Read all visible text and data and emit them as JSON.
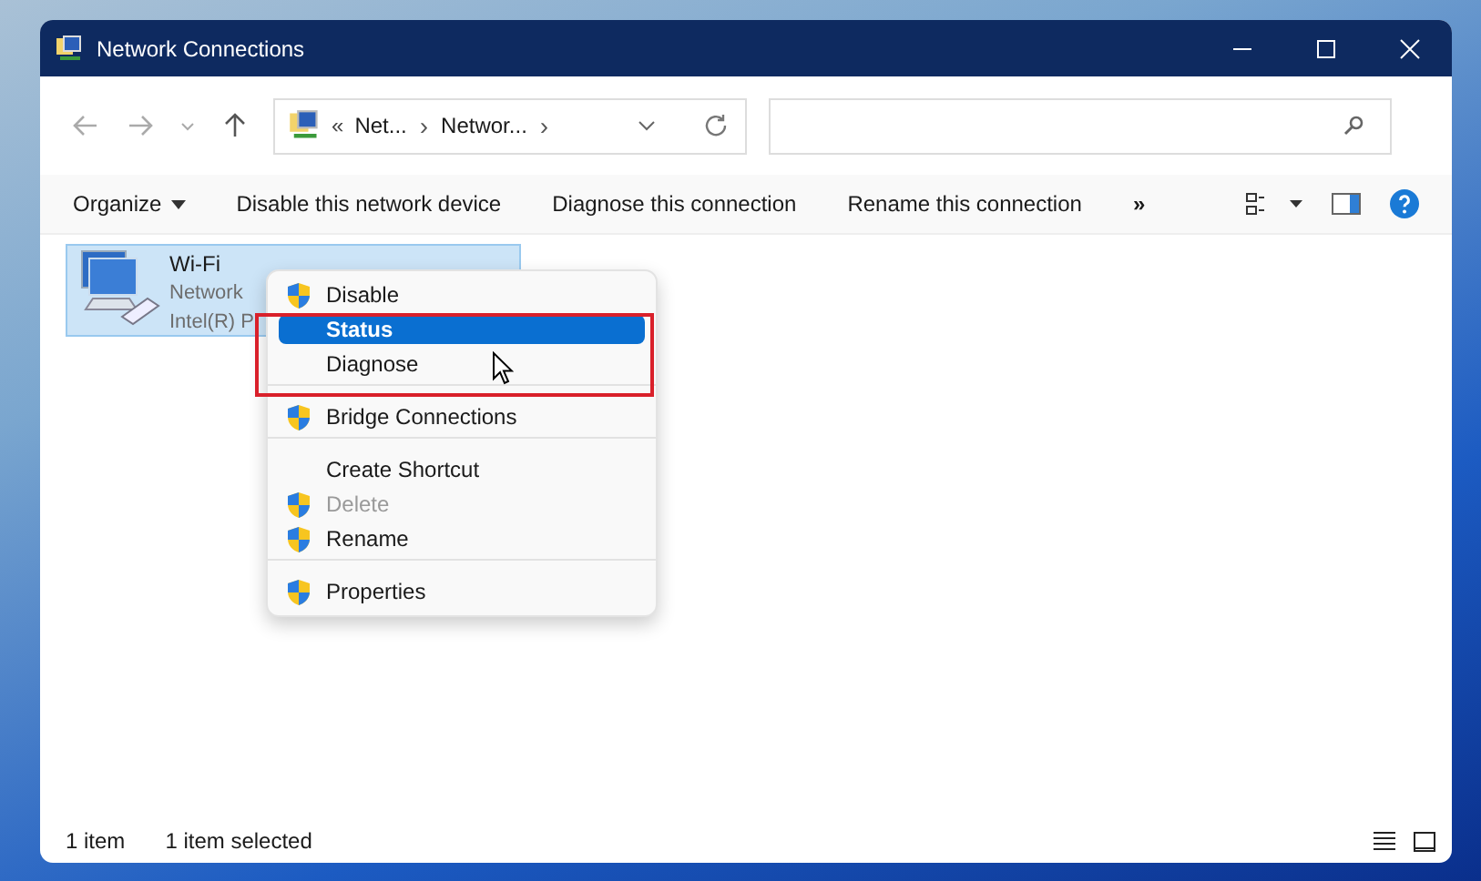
{
  "window": {
    "title": "Network Connections"
  },
  "address_bar": {
    "overflow": "«",
    "crumbs": [
      "Net...",
      "Networ..."
    ],
    "separator": "›"
  },
  "toolbar": {
    "items": [
      {
        "label": "Organize",
        "dropdown": true
      },
      {
        "label": "Disable this network device",
        "dropdown": false
      },
      {
        "label": "Diagnose this connection",
        "dropdown": false
      },
      {
        "label": "Rename this connection",
        "dropdown": false
      }
    ],
    "more": "»"
  },
  "connections": [
    {
      "name": "Wi-Fi",
      "line_2": "Network",
      "line_3": "Intel(R) P",
      "selected": true
    }
  ],
  "context_menu": {
    "items": [
      {
        "label": "Disable",
        "shield": true,
        "disabled": false,
        "selected": false,
        "separator_after": false
      },
      {
        "label": "Status",
        "shield": false,
        "disabled": false,
        "selected": true,
        "separator_after": false
      },
      {
        "label": "Diagnose",
        "shield": false,
        "disabled": false,
        "selected": false,
        "separator_after": true
      },
      {
        "label": "Bridge Connections",
        "shield": true,
        "disabled": false,
        "selected": false,
        "separator_after": true
      },
      {
        "label": "Create Shortcut",
        "shield": false,
        "disabled": false,
        "selected": false,
        "separator_after": false
      },
      {
        "label": "Delete",
        "shield": true,
        "disabled": true,
        "selected": false,
        "separator_after": false
      },
      {
        "label": "Rename",
        "shield": true,
        "disabled": false,
        "selected": false,
        "separator_after": true
      },
      {
        "label": "Properties",
        "shield": true,
        "disabled": false,
        "selected": false,
        "separator_after": false
      }
    ]
  },
  "status_bar": {
    "count": "1 item",
    "selection": "1 item selected"
  }
}
